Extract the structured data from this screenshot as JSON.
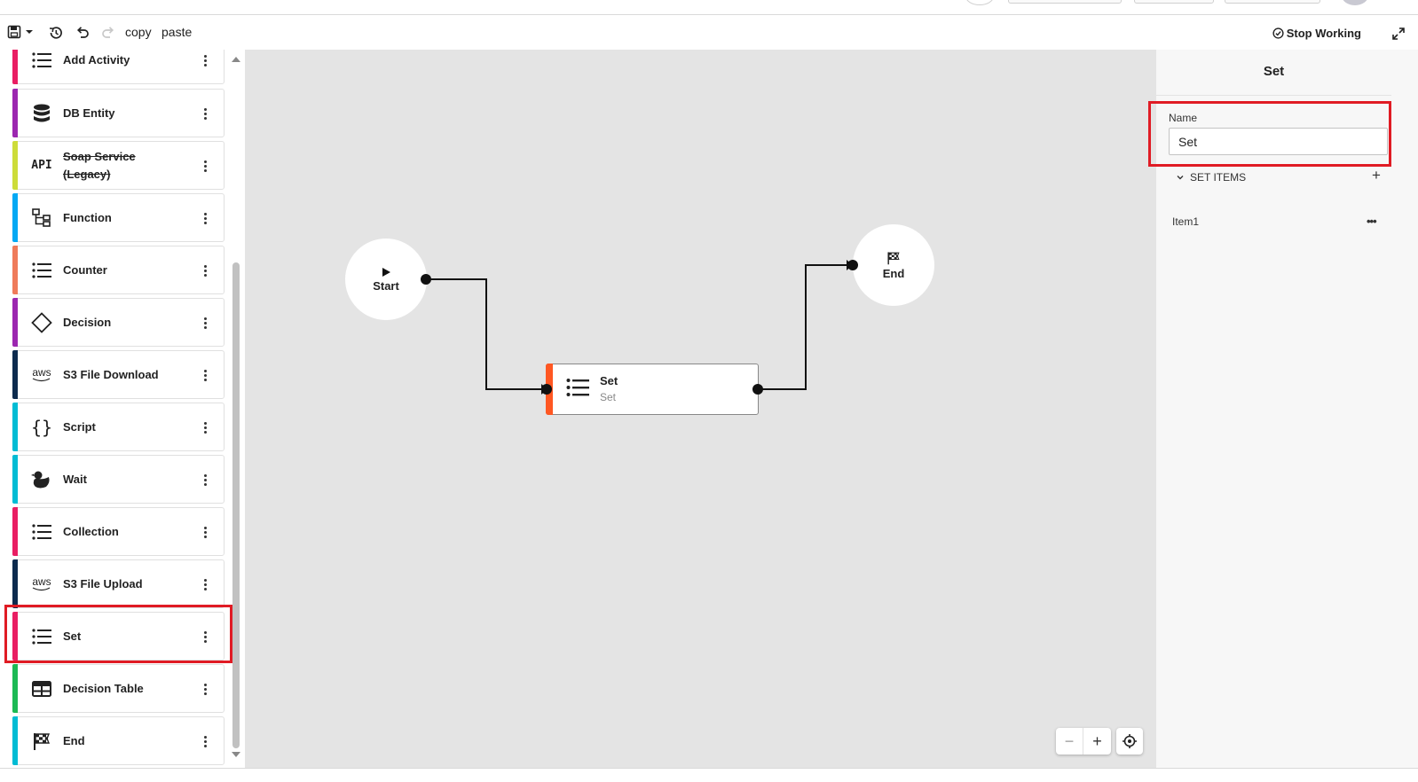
{
  "toolbar": {
    "copy_label": "copy",
    "paste_label": "paste",
    "stop_working_label": "Stop Working"
  },
  "palette": {
    "items": [
      {
        "label": "Add Activity",
        "icon": "list-icon",
        "color": "#e91e63"
      },
      {
        "label": "DB Entity",
        "icon": "database-icon",
        "color": "#9c27b0"
      },
      {
        "label": "Soap Service (Legacy)",
        "icon": "api-icon",
        "icon_text": "API",
        "color": "#cddc39",
        "deprecated": true
      },
      {
        "label": "Function",
        "icon": "function-tree-icon",
        "color": "#03a9f4"
      },
      {
        "label": "Counter",
        "icon": "list-icon",
        "color": "#ef7b5a"
      },
      {
        "label": "Decision",
        "icon": "diamond-icon",
        "color": "#9c27b0"
      },
      {
        "label": "S3 File Download",
        "icon": "aws-icon",
        "icon_text": "aws",
        "color": "#0d2b4e"
      },
      {
        "label": "Script",
        "icon": "braces-icon",
        "icon_text": "{}",
        "color": "#00bcd4"
      },
      {
        "label": "Wait",
        "icon": "duck-icon",
        "color": "#00bcd4"
      },
      {
        "label": "Collection",
        "icon": "list-icon",
        "color": "#e91e63"
      },
      {
        "label": "S3 File Upload",
        "icon": "aws-icon",
        "icon_text": "aws",
        "color": "#0d2b4e"
      },
      {
        "label": "Set",
        "icon": "list-icon",
        "color": "#e91e63"
      },
      {
        "label": "Decision Table",
        "icon": "table-icon",
        "color": "#1db954"
      },
      {
        "label": "End",
        "icon": "checkered-flag-icon",
        "color": "#00bcd4"
      }
    ]
  },
  "canvas": {
    "start_label": "Start",
    "end_label": "End",
    "set_node": {
      "title": "Set",
      "subtitle": "Set",
      "accent": "#ff5722"
    }
  },
  "panel": {
    "title": "Set",
    "name_label": "Name",
    "name_value": "Set",
    "set_items_label": "SET ITEMS",
    "items": [
      "Item1"
    ]
  },
  "colors": {
    "canvas_bg": "#e4e4e4",
    "highlight": "#e01b24"
  }
}
